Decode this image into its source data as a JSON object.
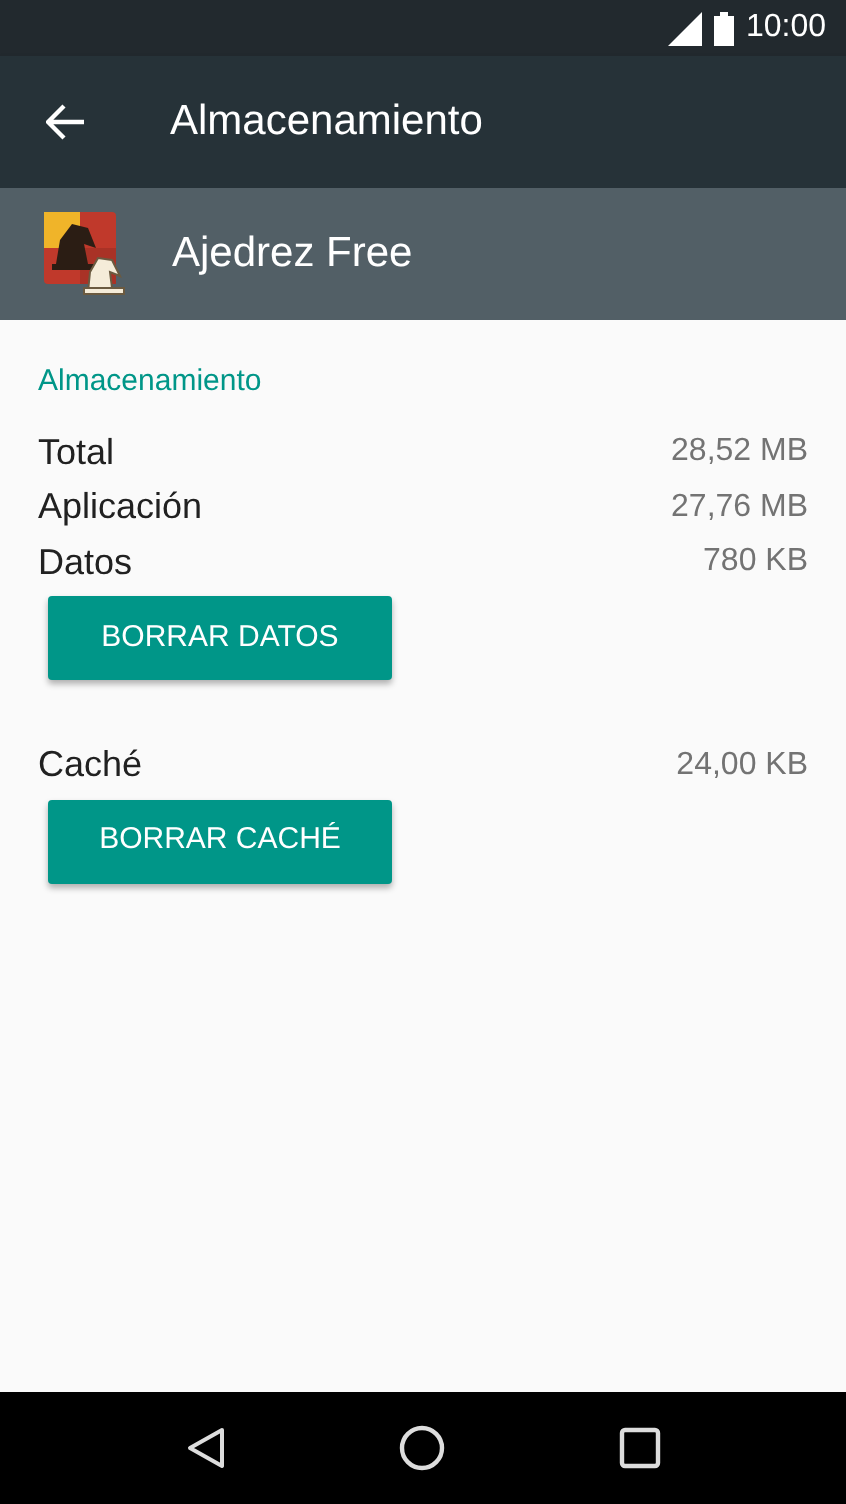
{
  "status_bar": {
    "time": "10:00"
  },
  "toolbar": {
    "title": "Almacenamiento"
  },
  "app": {
    "name": "Ajedrez Free"
  },
  "section": {
    "title": "Almacenamiento"
  },
  "items": [
    {
      "kind": "row",
      "label": "Total",
      "value": "28,52 MB"
    },
    {
      "kind": "row",
      "label": "Aplicación",
      "value": "27,76 MB"
    },
    {
      "kind": "row",
      "label": "Datos",
      "value": "780 KB"
    },
    {
      "kind": "button",
      "label": "BORRAR DATOS"
    },
    {
      "kind": "row",
      "label": "Caché",
      "value": "24,00 KB"
    },
    {
      "kind": "button",
      "label": "BORRAR CACHÉ"
    }
  ]
}
